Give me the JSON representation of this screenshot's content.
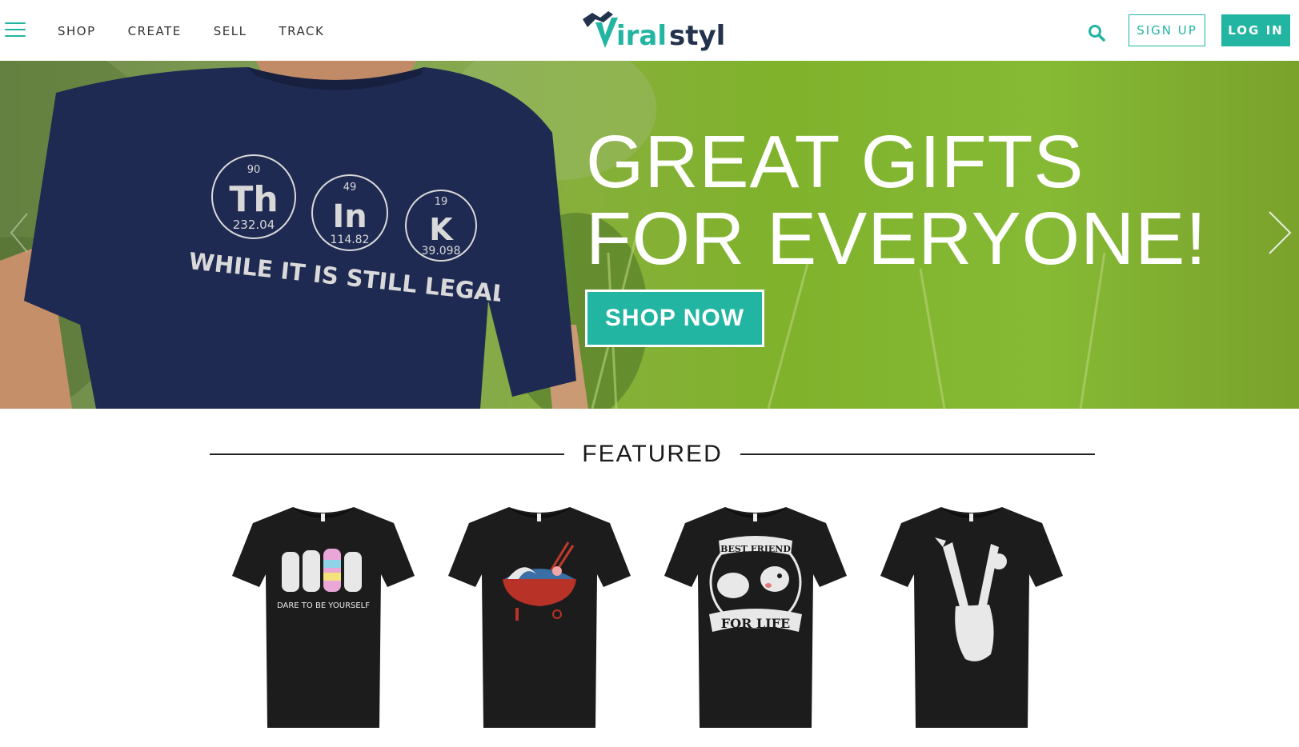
{
  "header": {
    "nav": [
      {
        "label": "SHOP"
      },
      {
        "label": "CREATE"
      },
      {
        "label": "SELL"
      },
      {
        "label": "TRACK"
      }
    ],
    "logo_text": "Viralstyle",
    "signup_label": "SIGN UP",
    "login_label": "LOG IN",
    "accent_color": "#22b5a2"
  },
  "hero": {
    "title_line1": "GREAT GIFTS",
    "title_line2": "FOR EVERYONE!",
    "cta_label": "SHOP NOW",
    "shirt_print": {
      "elements": [
        {
          "number": "90",
          "symbol": "Th",
          "mass": "232.04"
        },
        {
          "number": "49",
          "symbol": "In",
          "mass": "114.82"
        },
        {
          "number": "19",
          "symbol": "K",
          "mass": "39.098"
        }
      ],
      "slogan": "WHILE IT IS STILL LEGAL"
    }
  },
  "featured": {
    "heading": "FEATURED",
    "products": [
      {
        "icon": "tigers-shirt-icon",
        "print_text": "DARE TO BE YOURSELF"
      },
      {
        "icon": "ramen-wave-shirt-icon",
        "print_text": ""
      },
      {
        "icon": "dog-fist-bump-shirt-icon",
        "print_text_top": "BEST FRIEND",
        "print_text_bottom": "FOR LIFE"
      },
      {
        "icon": "guitar-peace-sign-shirt-icon",
        "print_text": ""
      }
    ]
  }
}
